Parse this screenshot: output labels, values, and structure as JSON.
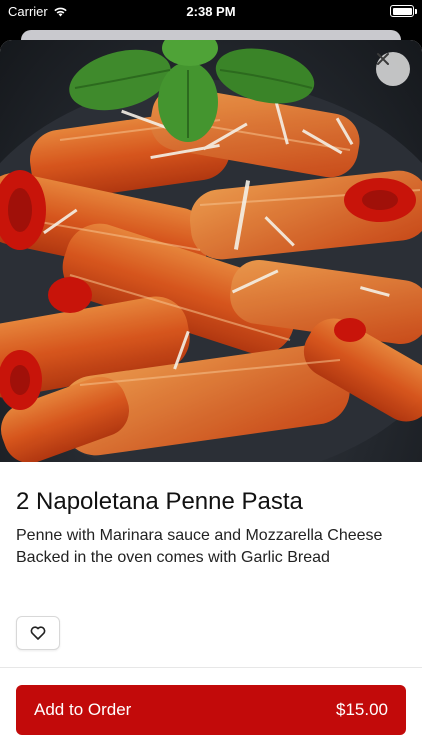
{
  "status_bar": {
    "carrier": "Carrier",
    "time": "2:38 PM"
  },
  "item": {
    "title": "2 Napoletana Penne Pasta",
    "description": "Penne with Marinara sauce and Mozzarella Cheese Backed in the oven comes with Garlic Bread",
    "image": "penne-pasta-photo"
  },
  "icons": {
    "close": "close-icon",
    "favorite": "heart-icon",
    "wifi": "wifi-icon",
    "battery": "battery-icon"
  },
  "order": {
    "label": "Add to Order",
    "price": "$15.00"
  },
  "colors": {
    "accent": "#c20a0a",
    "sheet_background": "#ffffff",
    "page_background": "#000000"
  }
}
